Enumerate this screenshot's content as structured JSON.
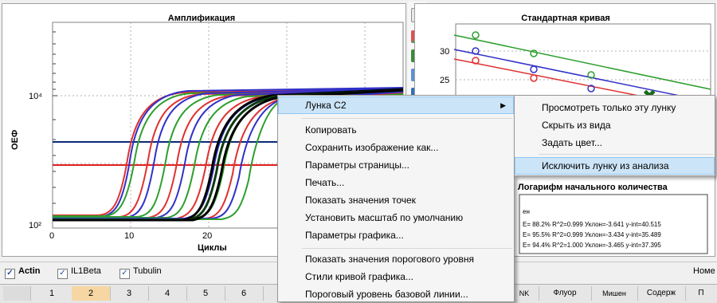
{
  "amplification": {
    "title": "Амплификация",
    "ylabel": "ОЕФ",
    "xlabel": "Циклы",
    "y_ticks": [
      "10⁴",
      "10²"
    ],
    "x_ticks": [
      "0",
      "10",
      "20"
    ]
  },
  "standard_curve": {
    "title": "Стандартная кривая",
    "y_ticks": [
      "30",
      "25"
    ],
    "log_label": "Логарифм начального количества",
    "legend_label": "ен",
    "legend": [
      "E= 88.2% R^2=0.999 Уклон=-3.641 y-int=40.515",
      "E= 95.5% R^2=0.999 Уклон=-3.434 y-int=35.489",
      "E= 94.4% R^2=1.000 Уклон=-3.465 y-int=37.395"
    ],
    "legend_colors": [
      "#2e9e2e",
      "#3030c8",
      "#e03030"
    ]
  },
  "targets": {
    "items": [
      {
        "label": "Actin",
        "checked": true
      },
      {
        "label": "IL1Beta",
        "checked": true
      },
      {
        "label": "Tubulin",
        "checked": true
      }
    ],
    "right_label": "Номе"
  },
  "plate_columns": [
    "1",
    "2",
    "3",
    "4",
    "5",
    "6"
  ],
  "grid_headers": [
    "NK",
    "Флуор",
    "Мишен",
    "Содерж",
    "П"
  ],
  "context_menu": {
    "header": "Лунка С2",
    "items": [
      "Копировать",
      "Сохранить изображение как...",
      "Параметры страницы...",
      "Печать...",
      "Показать значения точек",
      "Установить масштаб по умолчанию",
      "Параметры графика...",
      "Показать значения порогового уровня",
      "Стили кривой графика...",
      "Пороговый уровень базовой линии..."
    ]
  },
  "submenu": {
    "items": [
      "Просмотреть только эту лунку",
      "Скрыть из вида",
      "Задать цвет...",
      "Исключить лунку из анализа"
    ]
  },
  "colors": {
    "threshold_blue": "#0a2a78",
    "threshold_red": "#e02020",
    "menu_highlight": "#cce4f7"
  }
}
